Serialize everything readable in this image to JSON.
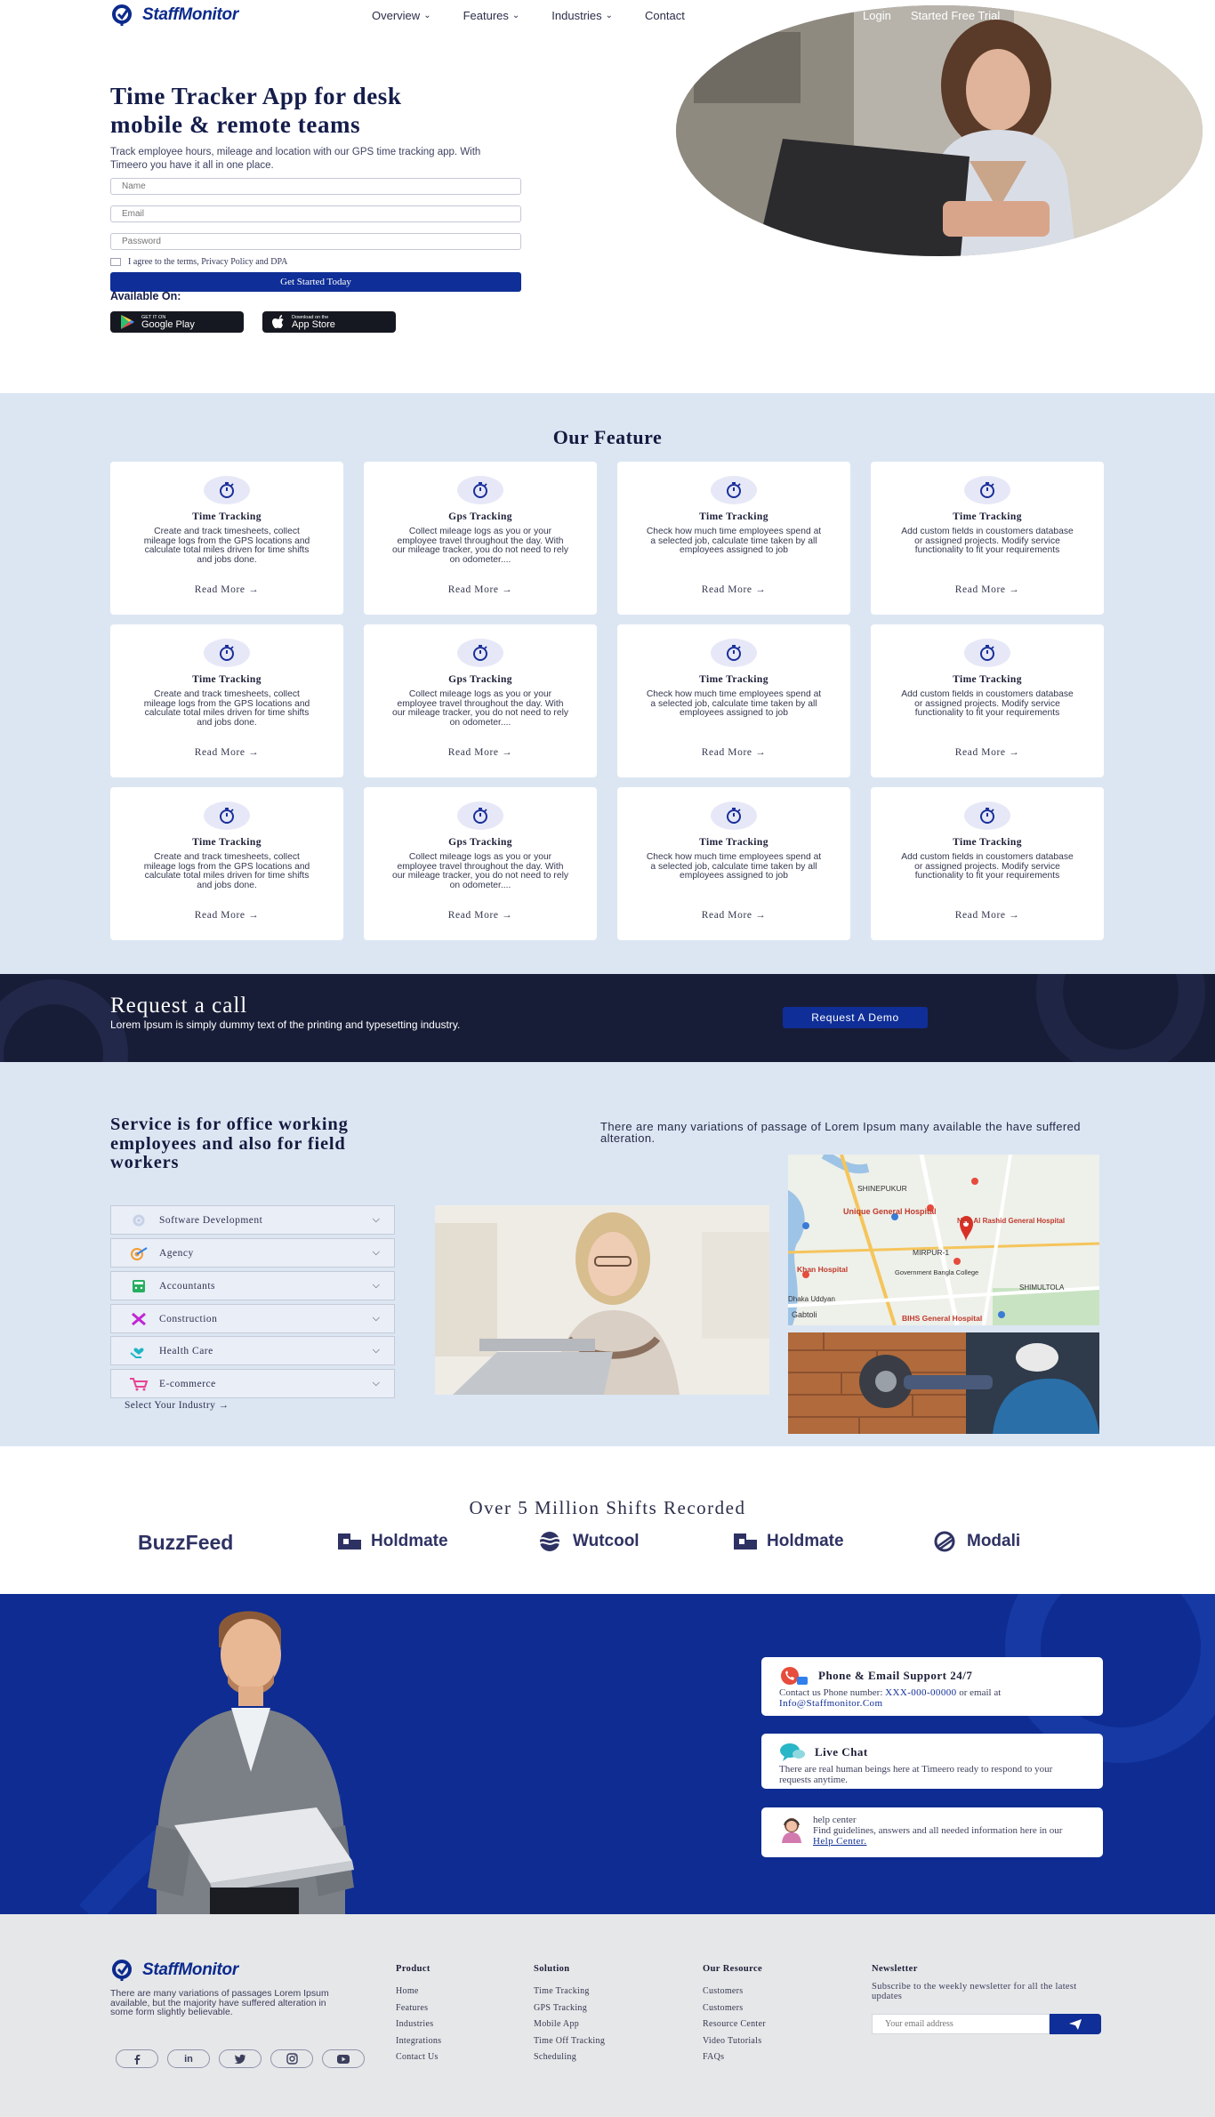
{
  "brand": {
    "name": "StaffMonitor"
  },
  "nav": {
    "items": [
      "Overview",
      "Features",
      "Industries",
      "Contact"
    ],
    "login": "Login",
    "trial": "Started Free Trial"
  },
  "hero": {
    "title_line1": "Time Tracker App for desk",
    "title_line2": "mobile & remote teams",
    "subtitle": "Track employee hours, mileage and location with our GPS time tracking app. With Timeero you have it all in one place.",
    "name_placeholder": "Name",
    "email_placeholder": "Email",
    "password_placeholder": "Password",
    "agree_text": "I agree to the terms, Privacy Policy and DPA",
    "cta": "Get Started Today",
    "available_on": "Available On:",
    "google_small": "GET IT ON",
    "google_big": "Google Play",
    "apple_small": "Download on the",
    "apple_big": "App Store"
  },
  "features": {
    "title": "Our Feature",
    "cards": [
      {
        "title": "Time Tracking",
        "desc": "Create and track timesheets, collect mileage logs from the GPS locations and calculate total miles driven for time shifts and jobs done.",
        "more": "Read More"
      },
      {
        "title": "Gps Tracking",
        "desc": "Collect mileage logs as you or your employee travel throughout the day. With our mileage tracker, you do not need to rely on odometer....",
        "more": "Read More"
      },
      {
        "title": "Time Tracking",
        "desc": "Check how much time employees spend at a selected job, calculate time taken by all employees assigned to job",
        "more": "Read More"
      },
      {
        "title": "Time Tracking",
        "desc": "Add custom fields in coustomers database or assigned projects. Modify service functionality to fit your requirements",
        "more": "Read More"
      },
      {
        "title": "Time Tracking",
        "desc": "Create and track timesheets, collect mileage logs from the GPS locations and calculate total miles driven for time shifts and jobs done.",
        "more": "Read More"
      },
      {
        "title": "Gps Tracking",
        "desc": "Collect mileage logs as you or your employee travel throughout the day. With our mileage tracker, you do not need to rely on odometer....",
        "more": "Read More"
      },
      {
        "title": "Time Tracking",
        "desc": "Check how much time employees spend at a selected job, calculate time taken by all employees assigned to job",
        "more": "Read More"
      },
      {
        "title": "Time Tracking",
        "desc": "Add custom fields in coustomers database or assigned projects. Modify service functionality to fit your requirements",
        "more": "Read More"
      },
      {
        "title": "Time Tracking",
        "desc": "Create and track timesheets, collect mileage logs from the GPS locations and calculate total miles driven for time shifts and jobs done.",
        "more": "Read More"
      },
      {
        "title": "Gps Tracking",
        "desc": "Collect mileage logs as you or your employee travel throughout the day. With our mileage tracker, you do not need to rely on odometer....",
        "more": "Read More"
      },
      {
        "title": "Time Tracking",
        "desc": "Check how much time employees spend at a selected job, calculate time taken by all employees assigned to job",
        "more": "Read More"
      },
      {
        "title": "Time Tracking",
        "desc": "Add custom fields in coustomers database or assigned projects. Modify service functionality to fit your requirements",
        "more": "Read More"
      }
    ]
  },
  "request": {
    "title": "Request a call",
    "text": "Lorem Ipsum is simply dummy text of the printing and typesetting industry.",
    "button": "Request A Demo"
  },
  "service": {
    "title": "Service is for office working employees and also for field workers",
    "intro": "There are many variations of passage of Lorem Ipsum many available the have suffered alteration.",
    "industries": [
      {
        "label": "Software Development",
        "icon": "gear-icon"
      },
      {
        "label": "Agency",
        "icon": "target-icon"
      },
      {
        "label": "Accountants",
        "icon": "calculator-icon"
      },
      {
        "label": "Construction",
        "icon": "tools-icon"
      },
      {
        "label": "Health Care",
        "icon": "hands-heart-icon"
      },
      {
        "label": "E-commerce",
        "icon": "cart-icon"
      }
    ],
    "select_link": "Select Your Industry",
    "map": {
      "labels": [
        "SHINEPUKUR",
        "Unique General Hospital",
        "New Al Rashid General Hospital",
        "MIRPUR-1",
        "Khan Hospital",
        "Government Bangla College",
        "SHIMULTOLA",
        "Gabtoli",
        "BIHS General Hospital",
        "Dhaka Uddyan"
      ]
    }
  },
  "partners": {
    "title": "Over 5 Million Shifts Recorded",
    "brands": [
      "BuzzFeed",
      "Holdmate",
      "Wutcool",
      "Holdmate",
      "Modali"
    ]
  },
  "support": {
    "phone_title": "Phone & Email Support 24/7",
    "phone_text1": "Contact us Phone number: ",
    "phone_number": "XXX-000-00000",
    "phone_text2": " or email at ",
    "email": "Info@Staffmonitor.Com",
    "chat_title": "Live Chat",
    "chat_text": "There are real human beings here at Timeero ready to respond to your requests anytime.",
    "help_title": "help center",
    "help_text": "Find guidelines, answers and all needed information here in our",
    "help_link": "Help Center."
  },
  "footer": {
    "about": "There are many variations of passages Lorem Ipsum available, but the majority have suffered alteration in some form slightly believable.",
    "socials": [
      "f",
      "in",
      "tw",
      "ig",
      "yt"
    ],
    "columns": [
      {
        "title": "Product",
        "links": [
          "Home",
          "Features",
          "Industries",
          "Integrations",
          "Contact Us"
        ]
      },
      {
        "title": "Solution",
        "links": [
          "Time Tracking",
          "GPS Tracking",
          "Mobile App",
          "Time Off Tracking",
          "Scheduling"
        ]
      },
      {
        "title": "Our Resource",
        "links": [
          "Customers",
          "Customers",
          "Resource Center",
          "Video Tutorials",
          "FAQs"
        ]
      }
    ],
    "newsletter_title": "Newsletter",
    "newsletter_text": "Subscribe to the weekly newsletter for all the latest updates",
    "newsletter_placeholder": "Your email address"
  },
  "colors": {
    "primary": "#0f2e97",
    "dark": "#181d37",
    "light_bg": "#dce6f3",
    "footer_bg": "#e6e7e9"
  }
}
